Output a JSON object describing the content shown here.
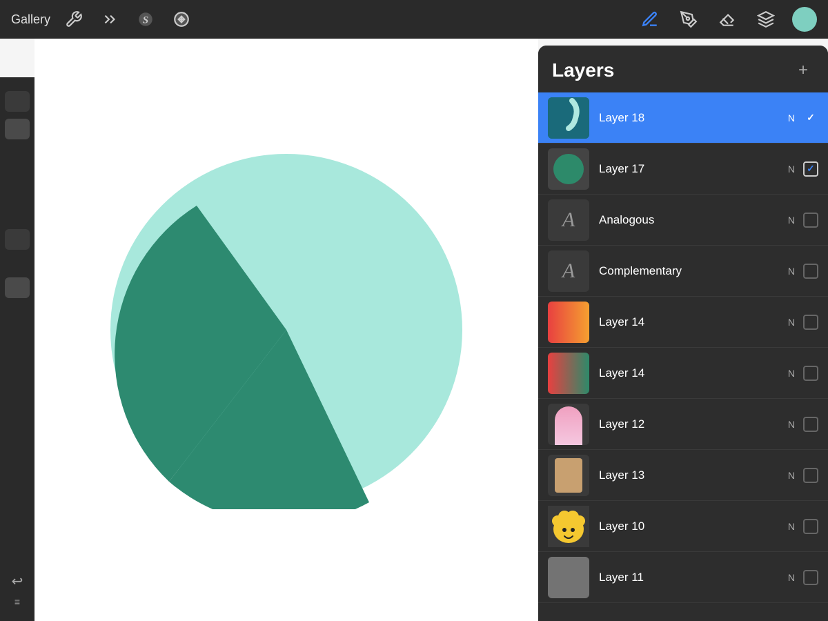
{
  "toolbar": {
    "gallery_label": "Gallery",
    "tools": [
      {
        "name": "wrench",
        "label": "Wrench"
      },
      {
        "name": "lightning",
        "label": "Adjustments"
      },
      {
        "name": "stylus",
        "label": "Stylus"
      },
      {
        "name": "arrow",
        "label": "Move"
      }
    ],
    "right_tools": [
      {
        "name": "pencil",
        "label": "Draw",
        "active": true
      },
      {
        "name": "pen-nib",
        "label": "Ink"
      },
      {
        "name": "eraser",
        "label": "Erase"
      },
      {
        "name": "layers",
        "label": "Layers"
      },
      {
        "name": "color-circle",
        "label": "Color"
      }
    ]
  },
  "layers_panel": {
    "title": "Layers",
    "add_button": "+",
    "layers": [
      {
        "id": "layer18",
        "name": "Layer 18",
        "mode": "N",
        "visible": true,
        "active": true,
        "thumb_type": "layer18"
      },
      {
        "id": "layer17",
        "name": "Layer 17",
        "mode": "N",
        "visible": true,
        "active": false,
        "thumb_type": "layer17"
      },
      {
        "id": "analogous",
        "name": "Analogous",
        "mode": "N",
        "visible": false,
        "active": false,
        "thumb_type": "analogous"
      },
      {
        "id": "complementary",
        "name": "Complementary",
        "mode": "N",
        "visible": false,
        "active": false,
        "thumb_type": "complementary"
      },
      {
        "id": "layer14a",
        "name": "Layer 14",
        "mode": "N",
        "visible": false,
        "active": false,
        "thumb_type": "layer14a"
      },
      {
        "id": "layer14b",
        "name": "Layer 14",
        "mode": "N",
        "visible": false,
        "active": false,
        "thumb_type": "layer14b"
      },
      {
        "id": "layer12",
        "name": "Layer 12",
        "mode": "N",
        "visible": false,
        "active": false,
        "thumb_type": "layer12"
      },
      {
        "id": "layer13",
        "name": "Layer 13",
        "mode": "N",
        "visible": false,
        "active": false,
        "thumb_type": "layer13"
      },
      {
        "id": "layer10",
        "name": "Layer 10",
        "mode": "N",
        "visible": false,
        "active": false,
        "thumb_type": "layer10"
      },
      {
        "id": "layer11",
        "name": "Layer 11",
        "mode": "N",
        "visible": false,
        "active": false,
        "thumb_type": "layer11"
      }
    ]
  },
  "canvas": {
    "background": "#ffffff"
  }
}
